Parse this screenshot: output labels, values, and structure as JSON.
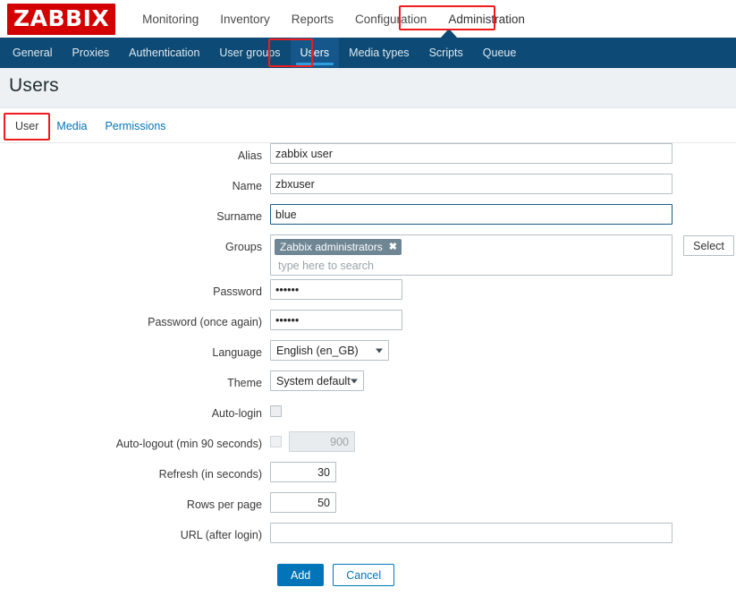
{
  "brand": {
    "logo_text": "ZABBIX",
    "logo_bg": "#d40000"
  },
  "main_nav": {
    "items": [
      {
        "label": "Monitoring"
      },
      {
        "label": "Inventory"
      },
      {
        "label": "Reports"
      },
      {
        "label": "Configuration"
      },
      {
        "label": "Administration"
      }
    ]
  },
  "sub_nav": {
    "items": [
      {
        "label": "General"
      },
      {
        "label": "Proxies"
      },
      {
        "label": "Authentication"
      },
      {
        "label": "User groups"
      },
      {
        "label": "Users"
      },
      {
        "label": "Media types"
      },
      {
        "label": "Scripts"
      },
      {
        "label": "Queue"
      }
    ]
  },
  "page": {
    "title": "Users"
  },
  "tabs": {
    "items": [
      {
        "label": "User"
      },
      {
        "label": "Media"
      },
      {
        "label": "Permissions"
      }
    ]
  },
  "form": {
    "alias": {
      "label": "Alias",
      "value": "zabbix user"
    },
    "name": {
      "label": "Name",
      "value": "zbxuser"
    },
    "surname": {
      "label": "Surname",
      "value": "blue"
    },
    "groups": {
      "label": "Groups",
      "chips": [
        {
          "label": "Zabbix administrators",
          "remove_icon": "✖"
        }
      ],
      "search_placeholder": "type here to search",
      "select_button": "Select"
    },
    "password": {
      "label": "Password",
      "value": "••••••"
    },
    "password_again": {
      "label": "Password (once again)",
      "value": "••••••"
    },
    "language": {
      "label": "Language",
      "value": "English (en_GB)"
    },
    "theme": {
      "label": "Theme",
      "value": "System default"
    },
    "auto_login": {
      "label": "Auto-login",
      "checked": false
    },
    "auto_logout": {
      "label": "Auto-logout (min 90 seconds)",
      "checked": false,
      "value": "900",
      "disabled": true
    },
    "refresh": {
      "label": "Refresh (in seconds)",
      "value": "30"
    },
    "rows_per_page": {
      "label": "Rows per page",
      "value": "50"
    },
    "url": {
      "label": "URL (after login)",
      "value": ""
    }
  },
  "actions": {
    "add": "Add",
    "cancel": "Cancel"
  },
  "colors": {
    "brand_red": "#d40000",
    "nav_blue": "#0d4a75",
    "accent_blue": "#0275b8",
    "highlight_red": "#ee1c1c",
    "chip_grey": "#6f8694"
  }
}
